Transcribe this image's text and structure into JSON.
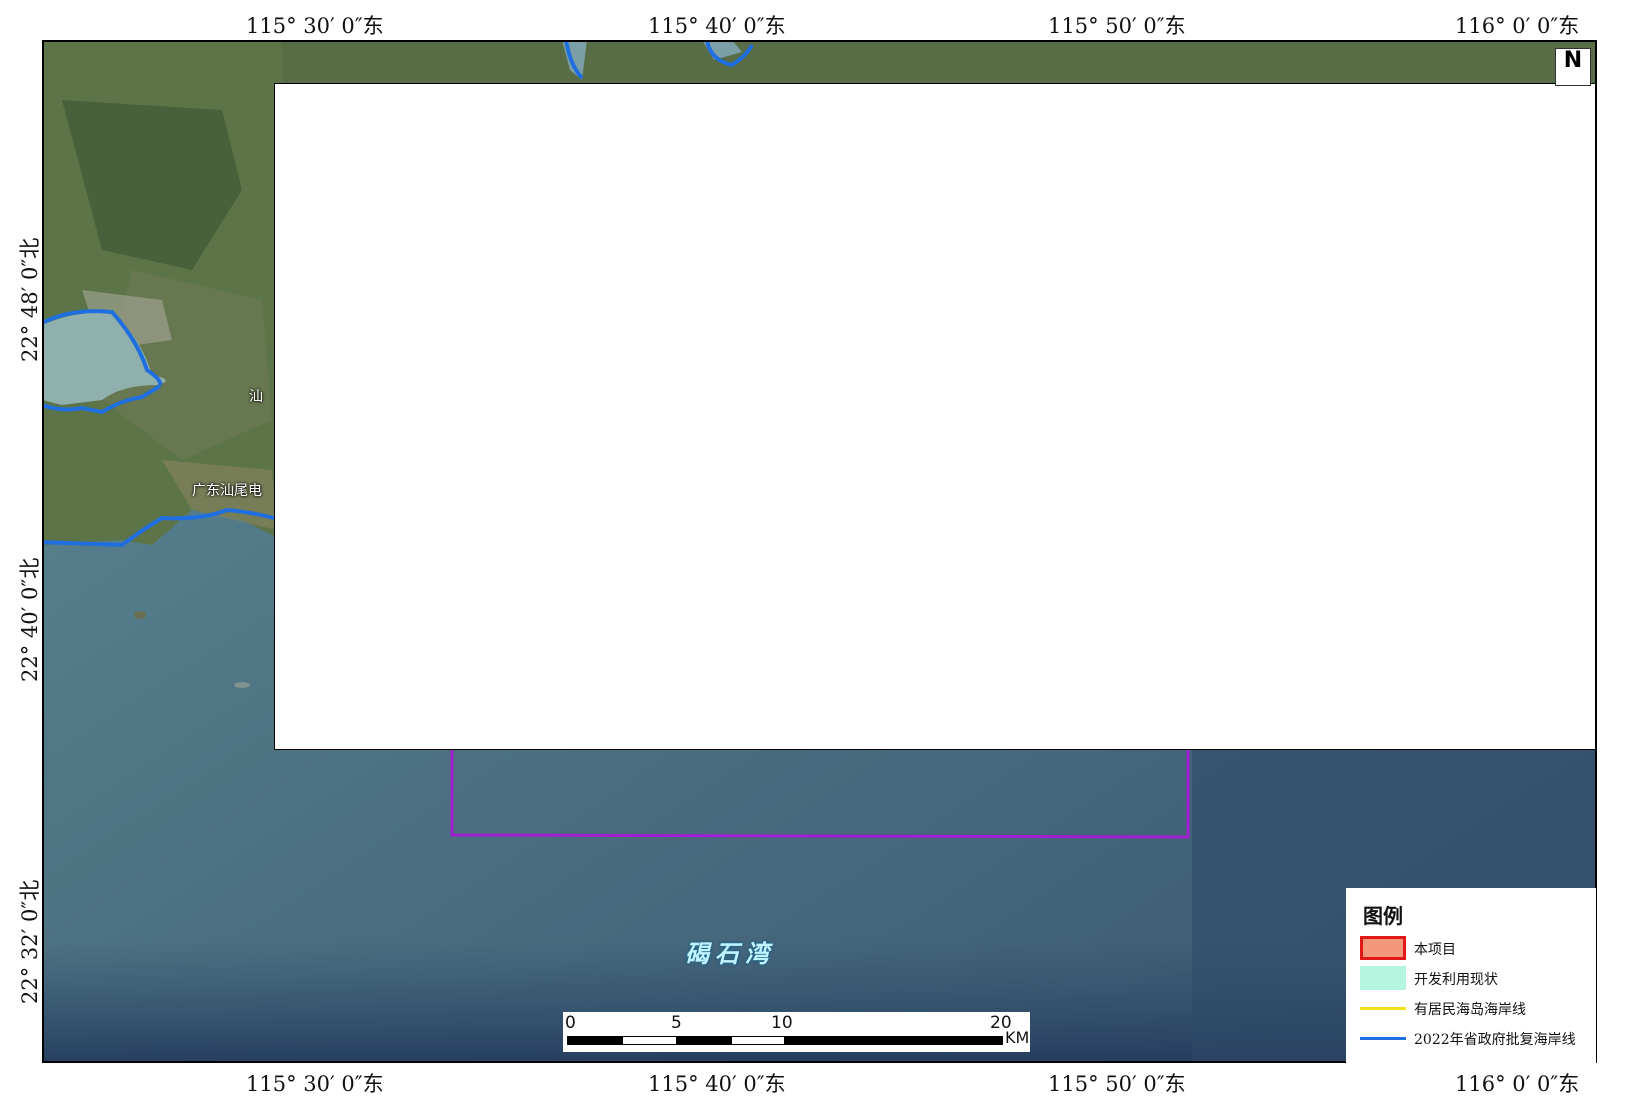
{
  "map": {
    "lon_ticks": [
      "115° 30′ 0″东",
      "115° 40′ 0″东",
      "115° 50′ 0″东",
      "116° 0′ 0″东"
    ],
    "lat_ticks": [
      "22° 48′ 0″北",
      "22° 40′ 0″北",
      "22° 32′ 0″北"
    ],
    "north_label": "N",
    "place_labels": {
      "shanwei_partial": "汕",
      "power_plant": "广东汕尾电"
    },
    "bay_name": "碣石湾",
    "scalebar": {
      "numbers": [
        "0",
        "5",
        "10",
        "20"
      ],
      "unit": "KM"
    },
    "colors": {
      "coastline": "#1f6fe0",
      "study_area": "#a020d0",
      "project_fill": "#f3987a",
      "project_stroke": "#e01818",
      "development_fill": "#b6f5e0",
      "island_line": "#f0e020"
    }
  },
  "legend": {
    "title": "图例",
    "items": [
      {
        "label": "本项目",
        "kind": "fill"
      },
      {
        "label": "开发利用现状",
        "kind": "fill"
      },
      {
        "label": "有居民海岛海岸线",
        "kind": "line"
      },
      {
        "label": "2022年省政府批复海岸线",
        "kind": "line"
      }
    ]
  }
}
